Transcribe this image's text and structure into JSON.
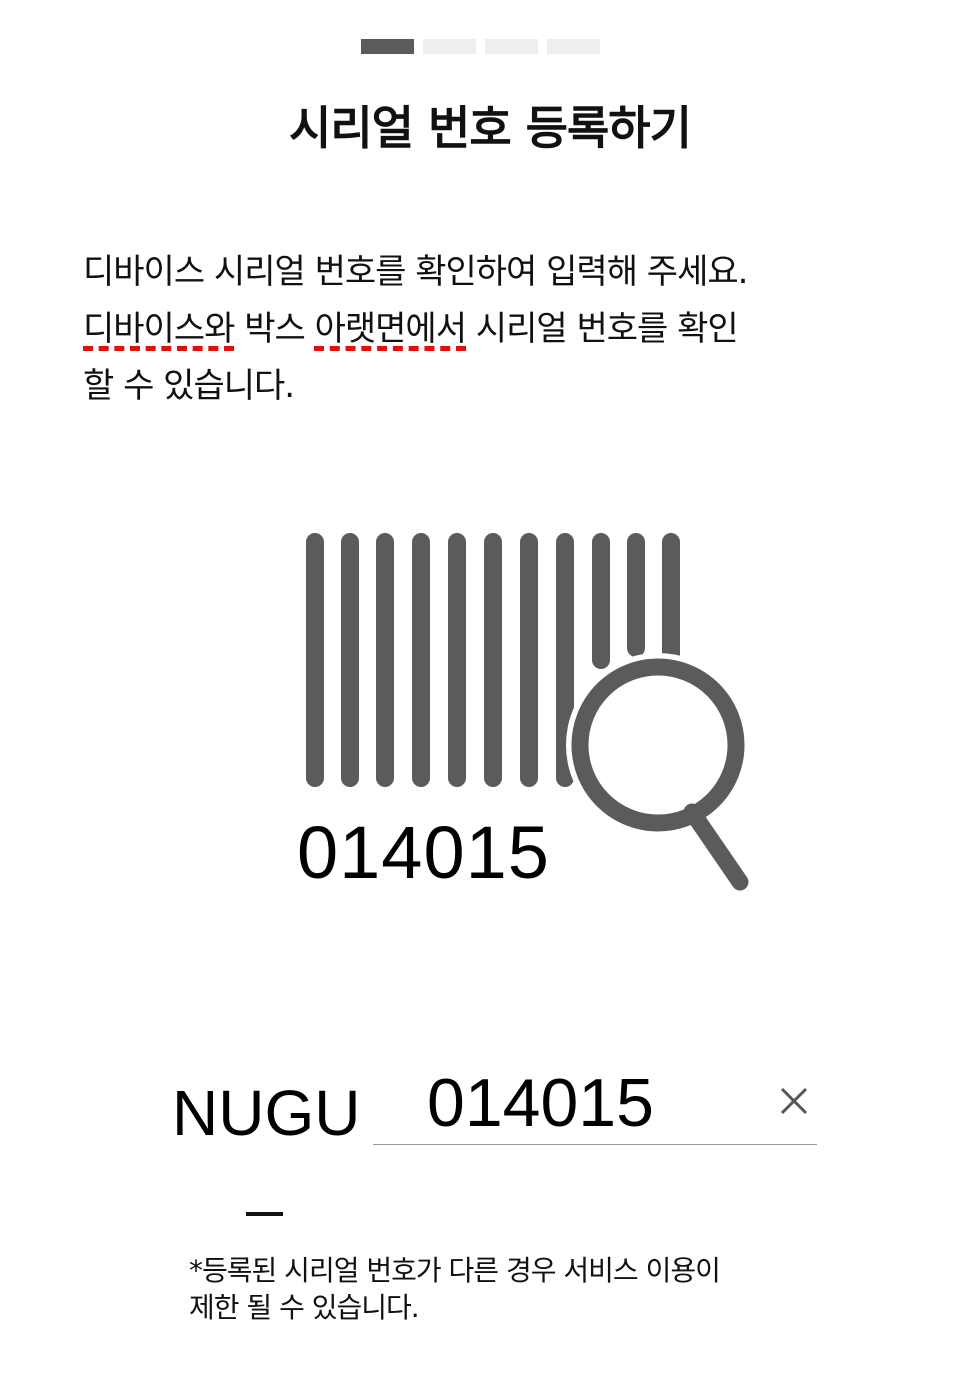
{
  "progress": {
    "total_steps": 4,
    "current_step": 1
  },
  "header": {
    "title": "시리얼 번호 등록하기"
  },
  "instructions": {
    "line1": "디바이스 시리얼 번호를 확인하여 입력해 주세요.",
    "line2_part1": "디바이스와",
    "line2_part2": " 박스 ",
    "line2_part3": "아랫면에서",
    "line2_part4": " 시리얼 번호를 확인",
    "line3": "할 수 있습니다."
  },
  "illustration": {
    "icon": "barcode-search-icon",
    "barcode_number": "014015",
    "color": "#5b5b5b"
  },
  "serial_form": {
    "prefix": "NUGU",
    "prefix_dash": "—",
    "value": "014015",
    "clear_icon": "close-icon"
  },
  "notice": {
    "line1": "*등록된 시리얼 번호가 다른 경우 서비스 이용이",
    "line2": "제한 될 수 있습니다."
  },
  "colors": {
    "active_step": "#5b5b5b",
    "inactive_step": "#eeeeee",
    "spellcheck": "#e01010"
  }
}
